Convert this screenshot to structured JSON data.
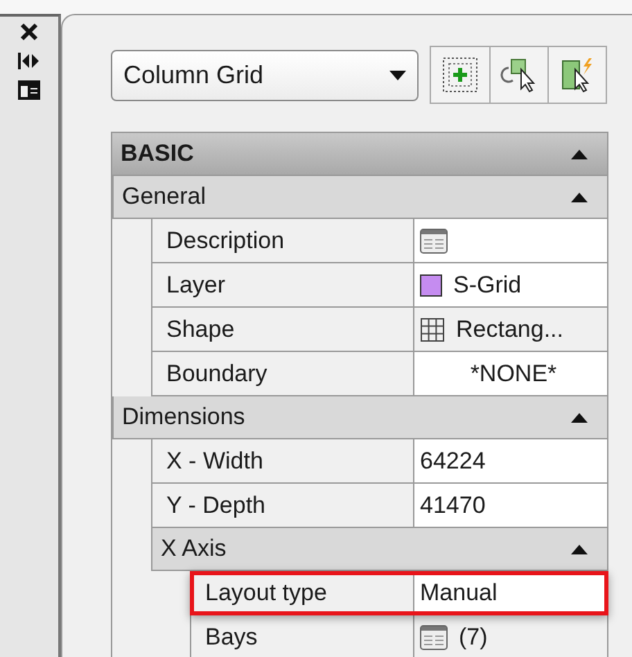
{
  "dropdown": {
    "value": "Column Grid"
  },
  "properties": [
    {
      "kind": "group",
      "title": "BASIC",
      "expanded": true,
      "children": [
        {
          "kind": "category",
          "title": "General",
          "expanded": true,
          "children": [
            {
              "kind": "dialog",
              "name": "Description",
              "editable": true,
              "highlighted": false
            },
            {
              "kind": "swatch",
              "name": "Layer",
              "value": "S-Grid",
              "color": "#c58cf0",
              "editable": true,
              "highlighted": false
            },
            {
              "kind": "grid",
              "name": "Shape",
              "value": "Rectang...",
              "editable": false,
              "highlighted": false
            },
            {
              "kind": "centered",
              "name": "Boundary",
              "value": "*NONE*",
              "editable": true,
              "highlighted": false
            }
          ]
        },
        {
          "kind": "category",
          "title": "Dimensions",
          "expanded": true,
          "children": [
            {
              "kind": "text",
              "name": "X - Width",
              "value": "64224",
              "editable": true,
              "highlighted": false
            },
            {
              "kind": "text",
              "name": "Y - Depth",
              "value": "41470",
              "editable": true,
              "highlighted": false
            },
            {
              "kind": "category",
              "title": "X Axis",
              "expanded": true,
              "children": [
                {
                  "kind": "text",
                  "name": "Layout type",
                  "value": "Manual",
                  "editable": true,
                  "highlighted": true
                },
                {
                  "kind": "dialog",
                  "name": "Bays",
                  "value": "(7)",
                  "editable": false,
                  "highlighted": false
                }
              ]
            }
          ]
        }
      ]
    }
  ]
}
